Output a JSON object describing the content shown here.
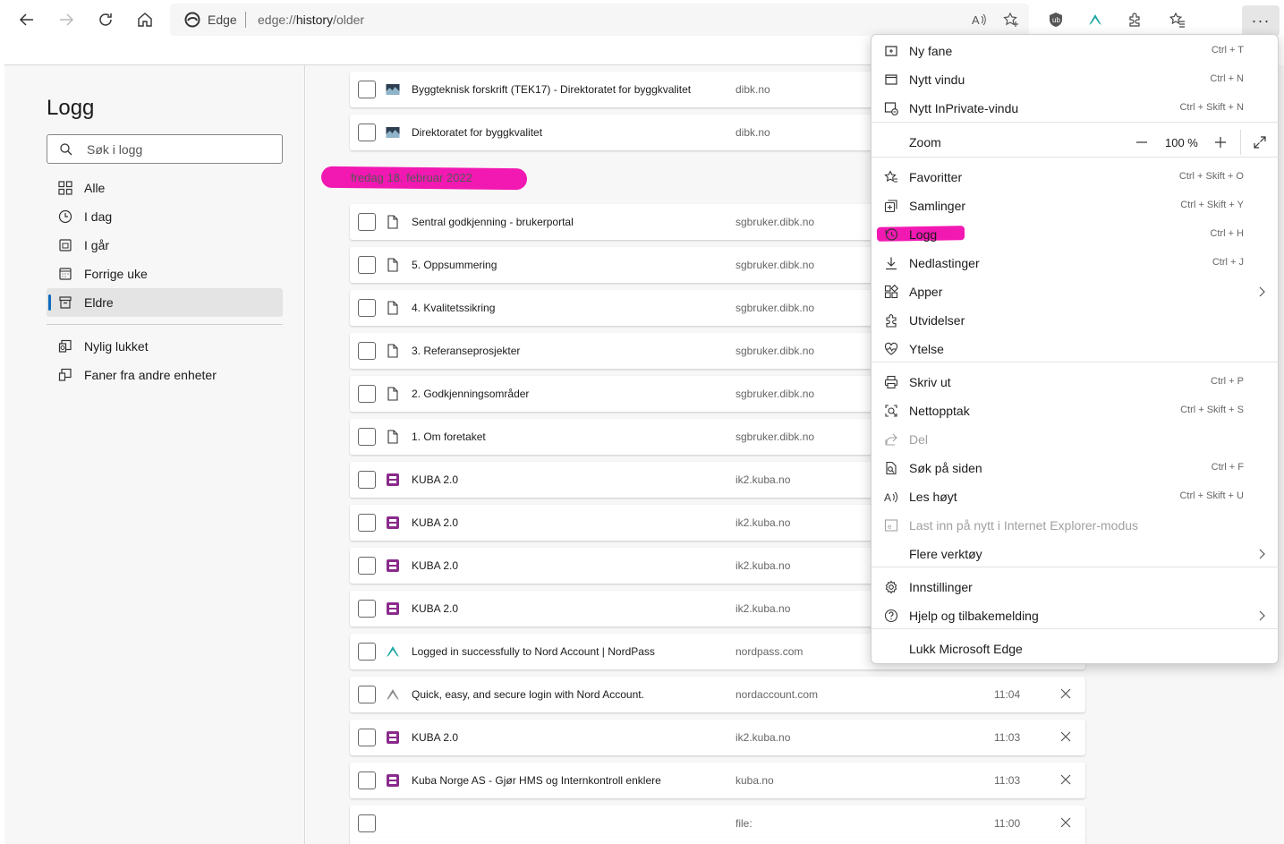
{
  "browser": {
    "address_label": "Edge",
    "url_prefix": "edge://",
    "url_path_bold": "history",
    "url_suffix": "/older",
    "more_label": "···"
  },
  "sidebar": {
    "title": "Logg",
    "search_placeholder": "Søk i logg",
    "items": [
      {
        "label": "Alle"
      },
      {
        "label": "I dag"
      },
      {
        "label": "I går"
      },
      {
        "label": "Forrige uke"
      },
      {
        "label": "Eldre"
      }
    ],
    "extra_items": [
      {
        "label": "Nylig lukket"
      },
      {
        "label": "Faner fra andre enheter"
      }
    ]
  },
  "history": {
    "date_heading": "fredag 18. februar 2022",
    "rows": [
      {
        "title": "Byggteknisk forskrift (TEK17) - Direktoratet for byggkvalitet",
        "domain": "dibk.no",
        "time": "",
        "favicon": "dibk-icon"
      },
      {
        "title": "Direktoratet for byggkvalitet",
        "domain": "dibk.no",
        "time": "",
        "favicon": "dibk-icon"
      },
      {
        "title": "Sentral godkjenning - brukerportal",
        "domain": "sgbruker.dibk.no",
        "time": "",
        "favicon": "page-icon"
      },
      {
        "title": "5. Oppsummering",
        "domain": "sgbruker.dibk.no",
        "time": "",
        "favicon": "page-icon"
      },
      {
        "title": "4. Kvalitetssikring",
        "domain": "sgbruker.dibk.no",
        "time": "",
        "favicon": "page-icon"
      },
      {
        "title": "3. Referanseprosjekter",
        "domain": "sgbruker.dibk.no",
        "time": "",
        "favicon": "page-icon"
      },
      {
        "title": "2. Godkjenningsområder",
        "domain": "sgbruker.dibk.no",
        "time": "",
        "favicon": "page-icon"
      },
      {
        "title": "1. Om foretaket",
        "domain": "sgbruker.dibk.no",
        "time": "",
        "favicon": "page-icon"
      },
      {
        "title": "KUBA 2.0",
        "domain": "ik2.kuba.no",
        "time": "",
        "favicon": "kuba-icon"
      },
      {
        "title": "KUBA 2.0",
        "domain": "ik2.kuba.no",
        "time": "",
        "favicon": "kuba-icon"
      },
      {
        "title": "KUBA 2.0",
        "domain": "ik2.kuba.no",
        "time": "",
        "favicon": "kuba-icon"
      },
      {
        "title": "KUBA 2.0",
        "domain": "ik2.kuba.no",
        "time": "",
        "favicon": "kuba-icon"
      },
      {
        "title": "Logged in successfully to Nord Account | NordPass",
        "domain": "nordpass.com",
        "time": "",
        "favicon": "nord-icon-teal"
      },
      {
        "title": "Quick, easy, and secure login with Nord Account.",
        "domain": "nordaccount.com",
        "time": "11:04",
        "favicon": "nord-icon-gray"
      },
      {
        "title": "KUBA 2.0",
        "domain": "ik2.kuba.no",
        "time": "11:03",
        "favicon": "kuba-icon"
      },
      {
        "title": "Kuba Norge AS - Gjør HMS og Internkontroll enklere",
        "domain": "kuba.no",
        "time": "11:03",
        "favicon": "kuba-icon"
      },
      {
        "title": "",
        "domain": "file:",
        "time": "11:00",
        "favicon": "none"
      }
    ]
  },
  "menu": {
    "items": [
      {
        "label": "Ny fane",
        "shortcut": "Ctrl + T"
      },
      {
        "label": "Nytt vindu",
        "shortcut": "Ctrl + N"
      },
      {
        "label": "Nytt InPrivate-vindu",
        "shortcut": "Ctrl + Skift + N"
      },
      {
        "label": "Zoom",
        "shortcut": ""
      },
      {
        "label": "Favoritter",
        "shortcut": "Ctrl + Skift + O"
      },
      {
        "label": "Samlinger",
        "shortcut": "Ctrl + Skift + Y"
      },
      {
        "label": "Logg",
        "shortcut": "Ctrl + H"
      },
      {
        "label": "Nedlastinger",
        "shortcut": "Ctrl + J"
      },
      {
        "label": "Apper",
        "shortcut": ""
      },
      {
        "label": "Utvidelser",
        "shortcut": ""
      },
      {
        "label": "Ytelse",
        "shortcut": ""
      },
      {
        "label": "Skriv ut",
        "shortcut": "Ctrl + P"
      },
      {
        "label": "Nettopptak",
        "shortcut": "Ctrl + Skift + S"
      },
      {
        "label": "Del",
        "shortcut": ""
      },
      {
        "label": "Søk på siden",
        "shortcut": "Ctrl + F"
      },
      {
        "label": "Les høyt",
        "shortcut": "Ctrl + Skift + U"
      },
      {
        "label": "Last inn på nytt i Internet Explorer-modus",
        "shortcut": ""
      },
      {
        "label": "Flere verktøy",
        "shortcut": ""
      },
      {
        "label": "Innstillinger",
        "shortcut": ""
      },
      {
        "label": "Hjelp og tilbakemelding",
        "shortcut": ""
      },
      {
        "label": "Lukk Microsoft Edge",
        "shortcut": ""
      }
    ],
    "zoom_value": "100 %",
    "highlight_color": "#f218b2"
  }
}
